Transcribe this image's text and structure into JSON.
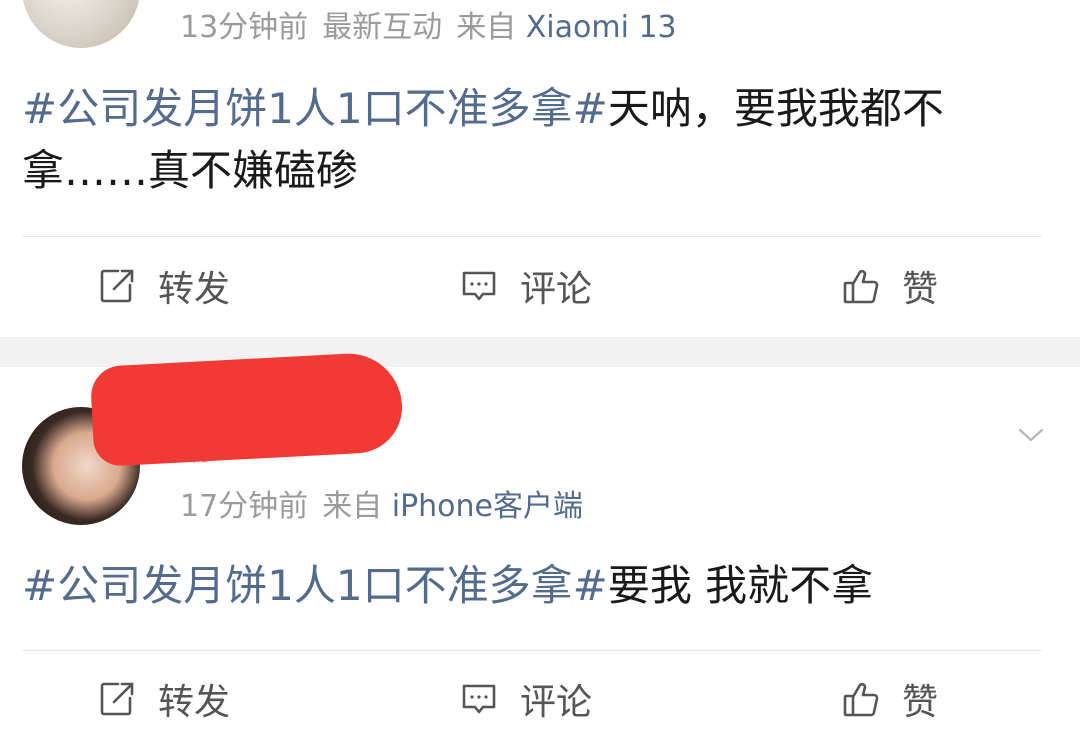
{
  "posts": [
    {
      "meta": {
        "time": "13分钟前",
        "label": "最新互动",
        "source_prefix": "来自",
        "source": "Xiaomi 13"
      },
      "content": {
        "hashtag": "#公司发月饼1人1口不准多拿#",
        "text": "天呐，要我我都不拿……真不嫌磕碜"
      },
      "actions": {
        "repost": "转发",
        "comment": "评论",
        "like": "赞"
      }
    },
    {
      "name": "娟",
      "meta": {
        "time": "17分钟前",
        "source_prefix": "来自",
        "source": "iPhone客户端"
      },
      "content": {
        "hashtag": "#公司发月饼1人1口不准多拿#",
        "text": "要我 我就不拿"
      },
      "actions": {
        "repost": "转发",
        "comment": "评论",
        "like": "赞"
      }
    }
  ],
  "icons": {
    "repost": "repost-icon",
    "comment": "comment-icon",
    "like": "thumbs-up-icon",
    "dropdown": "chevron-down-icon"
  },
  "colors": {
    "link": "#536b8c",
    "meta": "#9b9b9b",
    "text": "#1a1a1a",
    "separator": "#f2f2f2",
    "redaction": "#f23a35"
  }
}
